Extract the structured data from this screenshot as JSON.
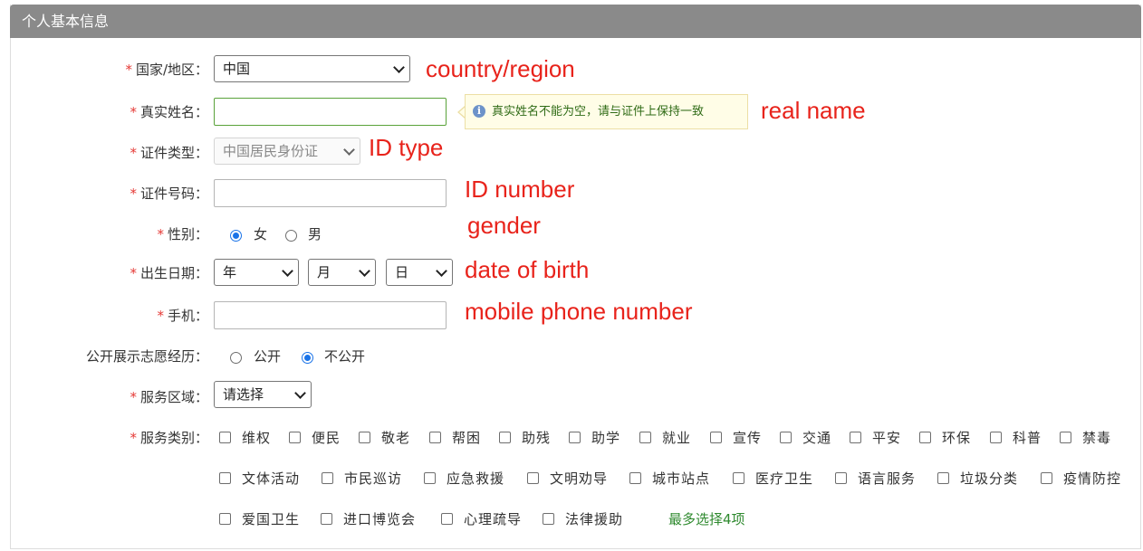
{
  "panel": {
    "title": "个人基本信息"
  },
  "fields": {
    "country": {
      "label": "国家/地区：",
      "value": "中国",
      "annotation": "country/region"
    },
    "real_name": {
      "label": "真实姓名：",
      "value": "",
      "annotation": "real name",
      "tooltip": "真实姓名不能为空，请与证件上保持一致"
    },
    "id_type": {
      "label": "证件类型：",
      "value": "中国居民身份证",
      "annotation": "ID type"
    },
    "id_number": {
      "label": "证件号码：",
      "value": "",
      "annotation": "ID number"
    },
    "gender": {
      "label": "性别：",
      "options": [
        "女",
        "男"
      ],
      "selected": "女",
      "annotation": "gender"
    },
    "birth": {
      "label": "出生日期：",
      "year": "年",
      "month": "月",
      "day": "日",
      "annotation": "date of birth"
    },
    "mobile": {
      "label": "手机：",
      "value": "",
      "annotation": "mobile phone number"
    },
    "public_history": {
      "label": "公开展示志愿经历：",
      "options": [
        "公开",
        "不公开"
      ],
      "selected": "不公开"
    },
    "service_area": {
      "label": "服务区域：",
      "value": "请选择"
    },
    "service_type": {
      "label": "服务类别：",
      "options": [
        "维权",
        "便民",
        "敬老",
        "帮困",
        "助残",
        "助学",
        "就业",
        "宣传",
        "交通",
        "平安",
        "环保",
        "科普",
        "禁毒",
        "文体活动",
        "市民巡访",
        "应急救援",
        "文明劝导",
        "城市站点",
        "医疗卫生",
        "语言服务",
        "垃圾分类",
        "疫情防控",
        "爱国卫生",
        "进口博览会",
        "心理疏导",
        "法律援助"
      ],
      "note": "最多选择4项"
    }
  },
  "required_marker": "*",
  "colors": {
    "header": "#8a8a8a",
    "required": "#e53935",
    "annotation": "#e8231b",
    "note": "#2f8a2f"
  },
  "icons": {
    "tooltip": "info-icon"
  }
}
